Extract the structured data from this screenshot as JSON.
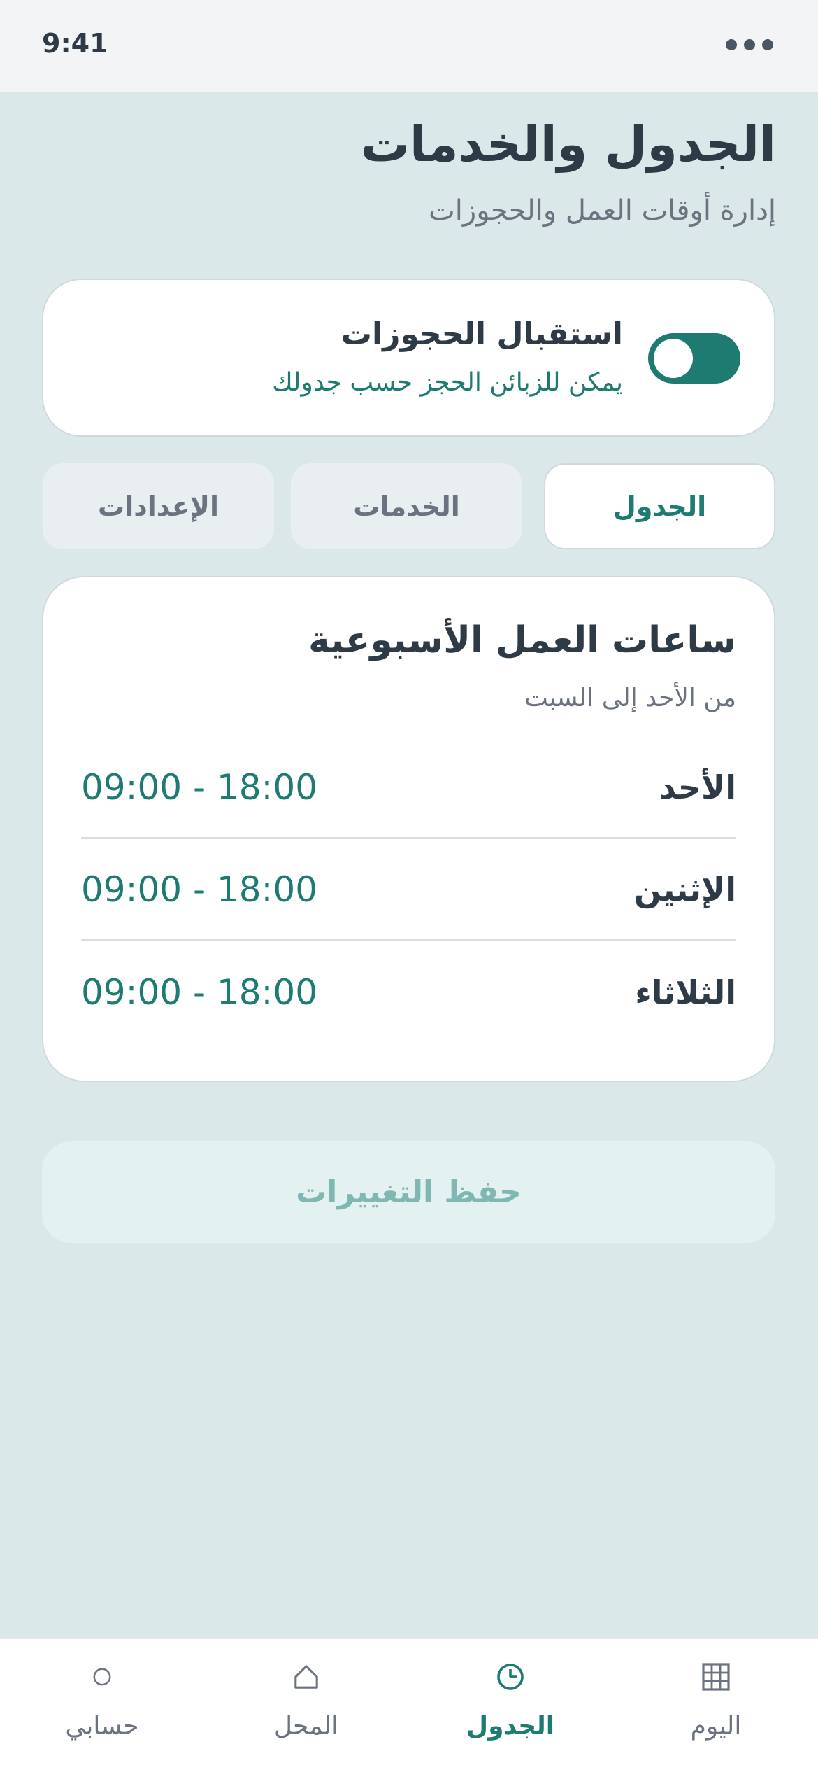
{
  "status_bar": {
    "time": "9:41",
    "more_icon": "more-dots-icon"
  },
  "header": {
    "title": "الجدول والخدمات",
    "subtitle": "إدارة أوقات العمل والحجوزات"
  },
  "booking_toggle": {
    "title": "استقبال الحجوزات",
    "description": "يمكن للزبائن الحجز حسب جدولك",
    "enabled": true
  },
  "tabs": [
    {
      "label": "الجدول",
      "active": true
    },
    {
      "label": "الخدمات",
      "active": false
    },
    {
      "label": "الإعدادات",
      "active": false
    }
  ],
  "hours_card": {
    "title": "ساعات العمل الأسبوعية",
    "subtitle": "من الأحد إلى السبت",
    "days": [
      {
        "day": "الأحد",
        "hours": "09:00 - 18:00"
      },
      {
        "day": "الإثنين",
        "hours": "09:00 - 18:00"
      },
      {
        "day": "الثلاثاء",
        "hours": "09:00 - 18:00"
      }
    ]
  },
  "save_button": {
    "label": "حفظ التغييرات"
  },
  "bottom_nav": [
    {
      "label": "اليوم",
      "icon": "calendar-grid-icon",
      "active": false
    },
    {
      "label": "الجدول",
      "icon": "clock-icon",
      "active": true
    },
    {
      "label": "المحل",
      "icon": "home-icon",
      "active": false
    },
    {
      "label": "حسابي",
      "icon": "profile-circle-icon",
      "active": false
    }
  ],
  "colors": {
    "accent": "#1e7b72",
    "background": "#dbe8e9",
    "text": "#2e3a46",
    "muted": "#6b7280"
  }
}
